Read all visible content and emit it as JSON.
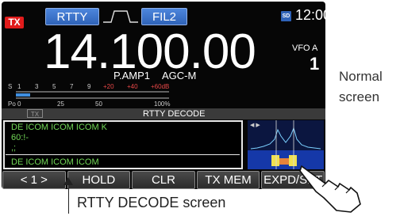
{
  "display": {
    "tx_badge": "TX",
    "mode": "RTTY",
    "filter": "FIL2",
    "clock": "12:00",
    "sd_label": "SD",
    "frequency": "14.100.00",
    "vfo_label": "VFO A",
    "vfo_num": "1",
    "preamp": "P.AMP1",
    "agc": "AGC-M"
  },
  "meter": {
    "s_label": "S",
    "s_ticks": [
      "1",
      "3",
      "5",
      "7",
      "9",
      "+20",
      "+40",
      "+60dB"
    ],
    "po_label": "Po",
    "po_ticks": [
      "0",
      "25",
      "50",
      "100%"
    ]
  },
  "decode": {
    "title": "RTTY DECODE",
    "tx_mini": "TX",
    "lines": [
      "DE ICOM ICOM ICOM K",
      "60:!-",
      ",;",
      "DE ICOM ICOM ICOM"
    ]
  },
  "softkeys": [
    {
      "label": "< 1 >"
    },
    {
      "label": "HOLD"
    },
    {
      "label": "CLR"
    },
    {
      "label": "TX MEM"
    },
    {
      "label": "EXPD/SET"
    }
  ],
  "annotations": {
    "normal_screen": "Normal screen",
    "decode_screen": "RTTY DECODE screen"
  },
  "colors": {
    "decode_text": "#72d857",
    "tx_red": "#e11b1b",
    "button_blue": "#2f63b8"
  }
}
